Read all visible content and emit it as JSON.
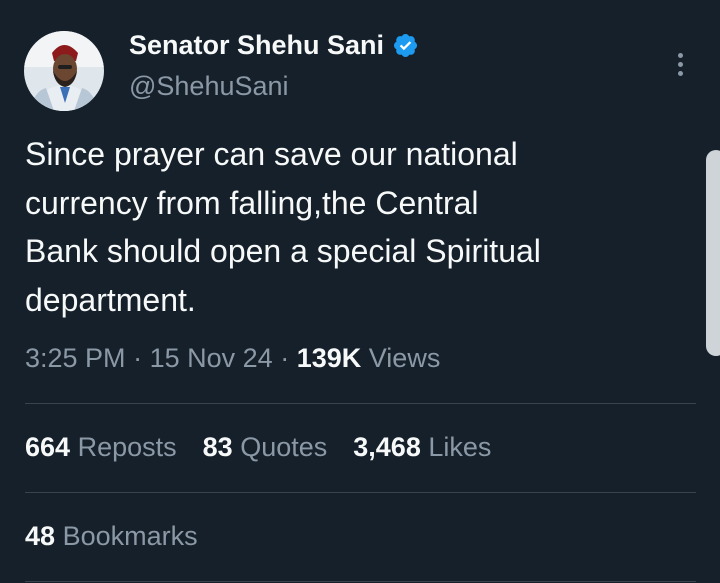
{
  "author": {
    "display_name": "Senator Shehu Sani",
    "handle": "@ShehuSani",
    "verified_icon": "verified-badge-icon",
    "avatar_icon": "avatar"
  },
  "tweet": {
    "text": "Since prayer can save our national\ncurrency from falling,the Central\nBank should open a special Spiritual\ndepartment.",
    "time": "3:25 PM",
    "date": "15 Nov 24",
    "separator": "·",
    "views_count": "139K",
    "views_label": "Views"
  },
  "stats": {
    "reposts_count": "664",
    "reposts_label": "Reposts",
    "quotes_count": "83",
    "quotes_label": "Quotes",
    "likes_count": "3,468",
    "likes_label": "Likes",
    "bookmarks_count": "48",
    "bookmarks_label": "Bookmarks"
  },
  "colors": {
    "background": "#15202b",
    "primary_text": "#f7f9f9",
    "secondary_text": "#8b98a5",
    "divider": "#38444d",
    "verified_blue": "#1d9bf0"
  }
}
